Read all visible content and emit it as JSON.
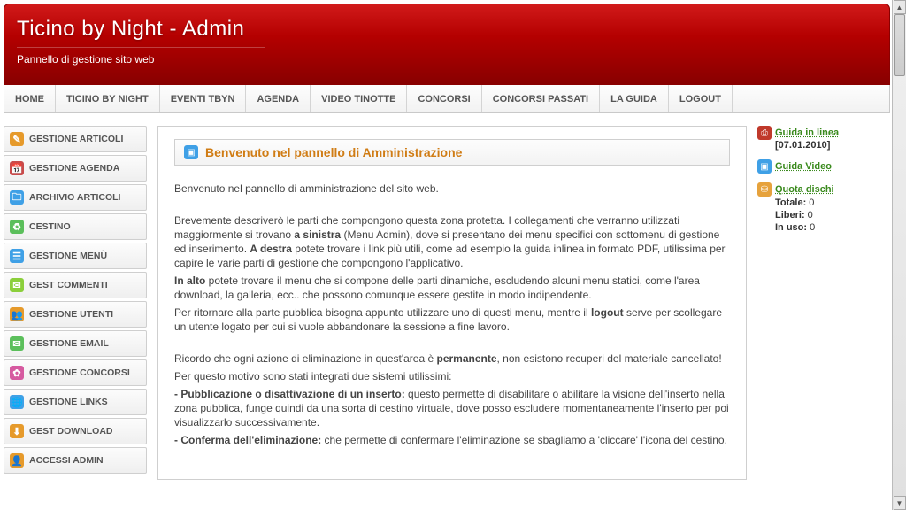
{
  "header": {
    "title": "Ticino by Night - Admin",
    "subtitle": "Pannello di gestione sito web"
  },
  "topnav": [
    "HOME",
    "TICINO BY NIGHT",
    "EVENTI TBYN",
    "AGENDA",
    "VIDEO TINOTTE",
    "CONCORSI",
    "CONCORSI PASSATI",
    "LA GUIDA",
    "LOGOUT"
  ],
  "sidebar": [
    {
      "label": "GESTIONE ARTICOLI",
      "icon": "✎",
      "bg": "#e69a2b"
    },
    {
      "label": "GESTIONE AGENDA",
      "icon": "📅",
      "bg": "#c94b4b"
    },
    {
      "label": "ARCHIVIO ARTICOLI",
      "icon": "🗀",
      "bg": "#3fa0e6"
    },
    {
      "label": "CESTINO",
      "icon": "♻",
      "bg": "#5bbf5b"
    },
    {
      "label": "GESTIONE MENÙ",
      "icon": "☰",
      "bg": "#3fa0e6"
    },
    {
      "label": "GEST COMMENTI",
      "icon": "✉",
      "bg": "#8bcf3b"
    },
    {
      "label": "GESTIONE UTENTI",
      "icon": "👥",
      "bg": "#e69a2b"
    },
    {
      "label": "GESTIONE EMAIL",
      "icon": "✉",
      "bg": "#5bbf5b"
    },
    {
      "label": "GESTIONE CONCORSI",
      "icon": "✿",
      "bg": "#d65aa0"
    },
    {
      "label": "GESTIONE LINKS",
      "icon": "🌐",
      "bg": "#3fa0e6"
    },
    {
      "label": "GEST DOWNLOAD",
      "icon": "⬇",
      "bg": "#e69a2b"
    },
    {
      "label": "ACCESSI ADMIN",
      "icon": "👤",
      "bg": "#e69a2b"
    }
  ],
  "welcome": {
    "title": "Benvenuto nel pannello di Amministrazione"
  },
  "content": {
    "p1": "Benvenuto nel pannello di amministrazione del sito web.",
    "p2a": "Brevemente descriverò le parti che compongono questa zona protetta. I collegamenti che verranno utilizzati maggiormente si trovano ",
    "p2b": "a sinistra",
    "p2c": " (Menu Admin), dove si presentano dei menu specifici con sottomenu di gestione ed inserimento. ",
    "p2d": "A destra",
    "p2e": " potete trovare i link più utili, come ad esempio la guida inlinea in formato PDF, utilissima per capire le varie parti di gestione che compongono l'applicativo.",
    "p3a": "In alto",
    "p3b": " potete trovare il menu che si compone delle parti dinamiche, escludendo alcuni menu statici, come l'area download, la galleria, ecc.. che possono comunque essere gestite in modo indipendente.",
    "p4a": "Per ritornare alla parte pubblica bisogna appunto utilizzare uno di questi menu, mentre il ",
    "p4b": "logout",
    "p4c": " serve per scollegare un utente logato per cui si vuole abbandonare la sessione a fine lavoro.",
    "p5a": "Ricordo che ogni azione di eliminazione in quest'area è ",
    "p5b": "permanente",
    "p5c": ", non esistono recuperi del materiale cancellato!",
    "p6": "Per questo motivo sono stati integrati due sistemi utilissimi:",
    "p7a": "- Pubblicazione o disattivazione di un inserto:",
    "p7b": " questo permette di disabilitare o abilitare la visione dell'inserto nella zona pubblica, funge quindi da una sorta di cestino virtuale, dove posso escludere momentaneamente l'inserto per poi visualizzarlo successivamente.",
    "p8a": "- Conferma dell'eliminazione:",
    "p8b": " che permette di confermare l'eliminazione se sbagliamo a 'cliccare' l'icona del cestino."
  },
  "right": {
    "guida_label": "Guida in linea",
    "guida_date": "[07.01.2010]",
    "video_label": "Guida Video",
    "quota_label": "Quota dischi",
    "stat_totale_l": "Totale:",
    "stat_totale_v": " 0",
    "stat_liberi_l": "Liberi:",
    "stat_liberi_v": " 0",
    "stat_inuso_l": "In uso:",
    "stat_inuso_v": " 0"
  }
}
